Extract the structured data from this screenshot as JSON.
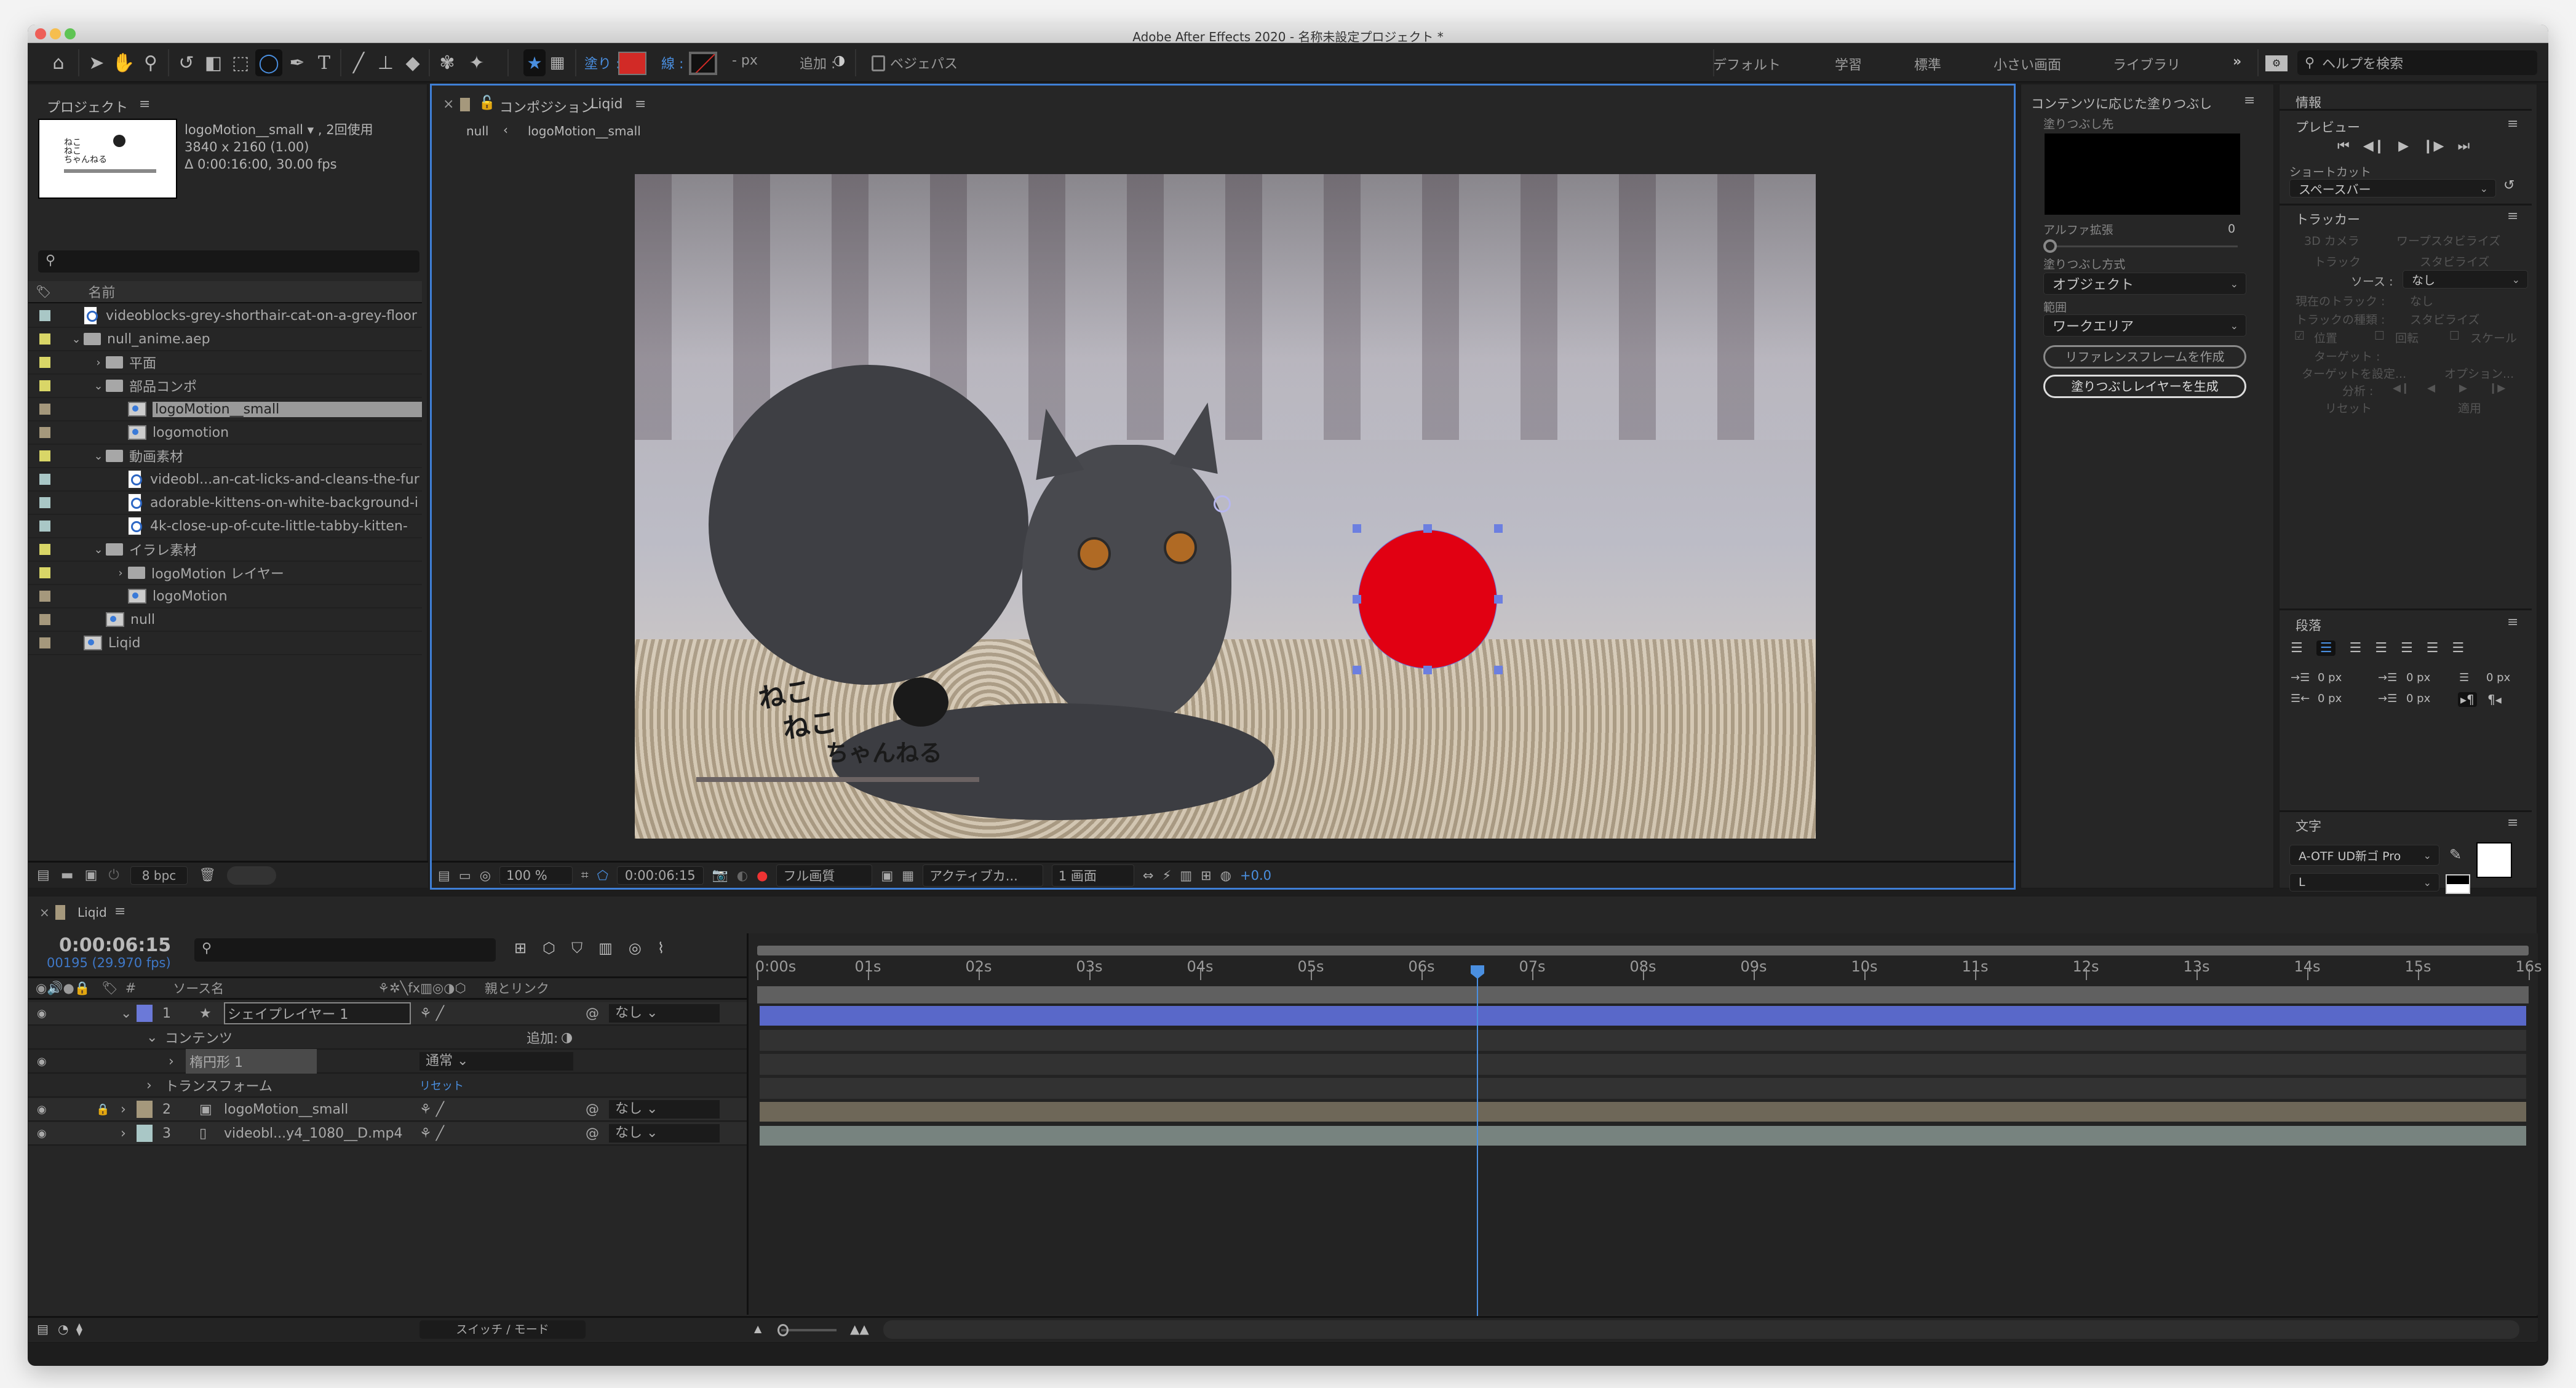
{
  "window": {
    "title": "Adobe After Effects 2020 - 名称未設定プロジェクト *"
  },
  "toolbar": {
    "tools": [
      "home-icon",
      "selection-icon",
      "hand-icon",
      "zoom-icon",
      "rotate-icon",
      "camera-orbit-icon",
      "pan-behind-icon",
      "ellipse-tool-icon",
      "pen-icon",
      "type-icon",
      "brush-icon",
      "clone-stamp-icon",
      "eraser-icon",
      "roto-brush-icon",
      "puppet-pin-icon"
    ],
    "fill_label": "塗り :",
    "stroke_label": "線 :",
    "stroke_width": "- px",
    "add_label": "追加 :",
    "bezier_label": "ベジェパス",
    "fill_color": "#d22a26"
  },
  "workspaces": [
    "デフォルト",
    "学習",
    "標準",
    "小さい画面",
    "ライブラリ"
  ],
  "workspaces_more": "»",
  "help_search_placeholder": "ヘルプを検索",
  "project": {
    "title": "プロジェクト",
    "selected_name": "logoMotion__small ▾ , 2回使用",
    "selected_dims": "3840 x 2160 (1.00)",
    "selected_duration": "Δ 0:00:16:00, 30.00 fps",
    "column_name": "名前",
    "items": [
      {
        "name": "videoblocks-grey-shorthair-cat-on-a-grey-floor",
        "type": "video",
        "color": "#a9c7c6",
        "indent": 0,
        "chevron": ""
      },
      {
        "name": "null_anime.aep",
        "type": "folder",
        "color": "#d9d667",
        "indent": 0,
        "chevron": "open"
      },
      {
        "name": "平面",
        "type": "folder",
        "color": "#d9d667",
        "indent": 1,
        "chevron": "closed"
      },
      {
        "name": "部品コンポ",
        "type": "folder",
        "color": "#d9d667",
        "indent": 1,
        "chevron": "open"
      },
      {
        "name": "logoMotion__small",
        "type": "comp",
        "color": "#a5987c",
        "indent": 2,
        "chevron": "",
        "selected": true
      },
      {
        "name": "logomotion",
        "type": "comp",
        "color": "#a5987c",
        "indent": 2,
        "chevron": ""
      },
      {
        "name": "動画素材",
        "type": "folder",
        "color": "#d9d667",
        "indent": 1,
        "chevron": "open"
      },
      {
        "name": "videobl...an-cat-licks-and-cleans-the-fur",
        "type": "video",
        "color": "#a9c7c6",
        "indent": 2,
        "chevron": ""
      },
      {
        "name": "adorable-kittens-on-white-background-i",
        "type": "video",
        "color": "#a9c7c6",
        "indent": 2,
        "chevron": ""
      },
      {
        "name": "4k-close-up-of-cute-little-tabby-kitten-",
        "type": "video",
        "color": "#a9c7c6",
        "indent": 2,
        "chevron": ""
      },
      {
        "name": "イラレ素材",
        "type": "folder",
        "color": "#d9d667",
        "indent": 1,
        "chevron": "open"
      },
      {
        "name": "logoMotion レイヤー",
        "type": "folder",
        "color": "#d9d667",
        "indent": 2,
        "chevron": "closed"
      },
      {
        "name": "logoMotion",
        "type": "comp",
        "color": "#a5987c",
        "indent": 2,
        "chevron": ""
      },
      {
        "name": "null",
        "type": "comp",
        "color": "#a5987c",
        "indent": 1,
        "chevron": ""
      },
      {
        "name": "Liqid",
        "type": "comp",
        "color": "#a5987c",
        "indent": 0,
        "chevron": ""
      }
    ],
    "bpc": "8 bpc"
  },
  "composition": {
    "tab_prefix": "コンポジション",
    "tab_name": "Liqid",
    "breadcrumb_parent": "null",
    "breadcrumb_child": "logoMotion__small",
    "zoom": "100 %",
    "timecode": "0:00:06:15",
    "resolution": "フル画質",
    "camera": "アクティブカ...",
    "views": "1 画面",
    "exposure": "+0.0",
    "logo_text_lines": [
      "ねこ",
      "ねこ",
      "ちゃんねる"
    ]
  },
  "content_aware_fill": {
    "title": "コンテンツに応じた塗りつぶし",
    "fill_target_label": "塗りつぶし先",
    "alpha_expansion_label": "アルファ拡張",
    "alpha_expansion_value": "0",
    "fill_method_label": "塗りつぶし方式",
    "fill_method_value": "オブジェクト",
    "range_label": "範囲",
    "range_value": "ワークエリア",
    "create_reference_button": "リファレンスフレームを作成",
    "generate_fill_button": "塗りつぶしレイヤーを生成"
  },
  "info": {
    "title": "情報"
  },
  "preview": {
    "title": "プレビュー",
    "shortcut_label": "ショートカット",
    "shortcut_value": "スペースバー"
  },
  "tracker": {
    "title": "トラッカー",
    "camera_3d": "3D カメラ",
    "warp_stabilize": "ワープスタビライズ",
    "track": "トラック",
    "stabilize": "スタビライズ",
    "source_label": "ソース :",
    "source_value": "なし",
    "current_track_label": "現在のトラック :",
    "current_track_value": "なし",
    "track_type_label": "トラックの種類 :",
    "track_type_value": "スタビライズ",
    "position": "位置",
    "rotation": "回転",
    "scale": "スケール",
    "target_label": "ターゲット :",
    "set_target": "ターゲットを設定...",
    "options": "オプション...",
    "analyze_label": "分析 :",
    "reset": "リセット",
    "apply": "適用"
  },
  "paragraph": {
    "title": "段落",
    "indent_left": "0 px",
    "space_before": "0 px",
    "first_line_indent": "0 px",
    "indent_right": "0 px",
    "space_after": "0 px"
  },
  "character": {
    "title": "文字",
    "font_family": "A-OTF UD新ゴ Pro",
    "font_style": "L"
  },
  "timeline": {
    "tab_name": "Liqid",
    "current_time": "0:00:06:15",
    "frame_info": "00195 (29.970 fps)",
    "col_source_name": "ソース名",
    "col_hash": "#",
    "col_parent": "親とリンク",
    "ruler_labels": [
      "0:00s",
      "01s",
      "02s",
      "03s",
      "04s",
      "05s",
      "06s",
      "07s",
      "08s",
      "09s",
      "10s",
      "11s",
      "12s",
      "13s",
      "14s",
      "15s",
      "16s"
    ],
    "duration_seconds": 16,
    "playhead_seconds": 6.5,
    "layers": [
      {
        "num": "1",
        "name": "シェイプレイヤー 1",
        "color": "#6b79d8",
        "parent": "なし",
        "type": "shape",
        "bar_color": "#5968c9"
      },
      {
        "num": "2",
        "name": "logoMotion__small",
        "color": "#a5987c",
        "parent": "なし",
        "type": "comp",
        "bar_color": "#6e6758",
        "locked": true
      },
      {
        "num": "3",
        "name": "videobl...y4_1080__D.mp4",
        "color": "#a9c7c6",
        "parent": "なし",
        "type": "video",
        "bar_color": "#77837f"
      }
    ],
    "contents_label": "コンテンツ",
    "add_label": "追加:",
    "ellipse_label": "楕円形 1",
    "blend_mode": "通常",
    "transform_label": "トランスフォーム",
    "reset_label": "リセット",
    "switch_mode": "スイッチ / モード"
  }
}
